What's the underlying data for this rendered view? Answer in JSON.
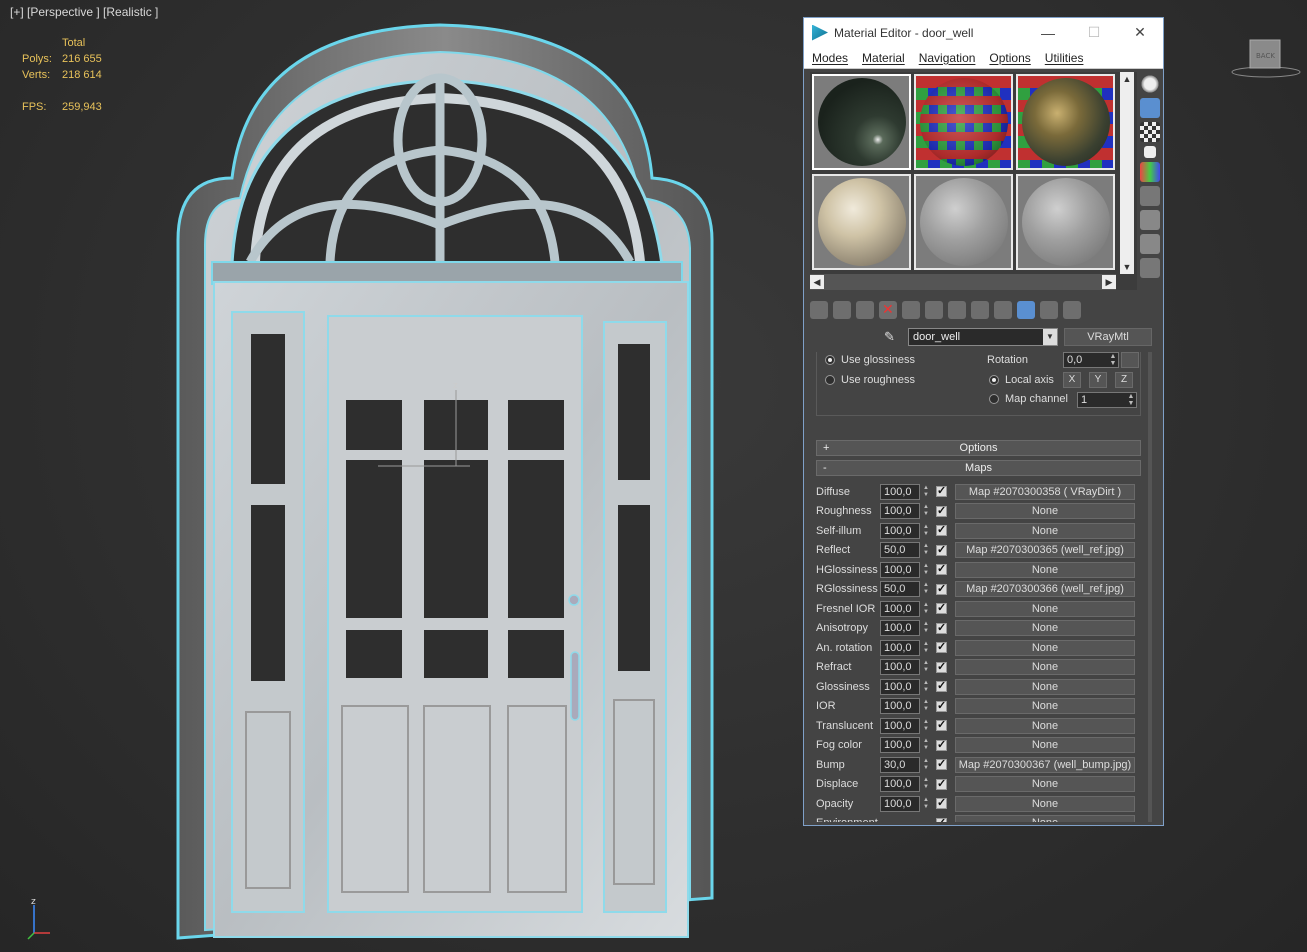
{
  "viewport": {
    "label": "[+] [Perspective ] [Realistic ]",
    "stats": {
      "header": "Total",
      "polys_label": "Polys:",
      "polys_value": "216 655",
      "verts_label": "Verts:",
      "verts_value": "218 614",
      "fps_label": "FPS:",
      "fps_value": "259,943"
    },
    "gizmo_axis_label": "z",
    "viewcube_label": "BACK"
  },
  "material_editor": {
    "title": "Material Editor - door_well",
    "window_buttons": {
      "minimize": "—",
      "maximize": "☐",
      "close": "✕"
    },
    "menu": [
      "Modes",
      "Material",
      "Navigation",
      "Options",
      "Utilities"
    ],
    "material_name": "door_well",
    "material_type": "VRayMtl",
    "glossiness": {
      "use_glossiness": "Use glossiness",
      "use_roughness": "Use roughness",
      "rotation_label": "Rotation",
      "rotation_value": "0,0",
      "local_axis": "Local axis",
      "axes": [
        "X",
        "Y",
        "Z"
      ],
      "map_channel": "Map channel",
      "map_channel_value": "1"
    },
    "sections": {
      "options": "Options",
      "options_sign": "+",
      "maps": "Maps",
      "maps_sign": "-"
    },
    "maps": [
      {
        "label": "Diffuse",
        "amount": "100,0",
        "map": "Map #2070300358  ( VRayDirt )"
      },
      {
        "label": "Roughness",
        "amount": "100,0",
        "map": "None"
      },
      {
        "label": "Self-illum",
        "amount": "100,0",
        "map": "None"
      },
      {
        "label": "Reflect",
        "amount": "50,0",
        "map": "Map #2070300365 (well_ref.jpg)"
      },
      {
        "label": "HGlossiness",
        "amount": "100,0",
        "map": "None"
      },
      {
        "label": "RGlossiness",
        "amount": "50,0",
        "map": "Map #2070300366 (well_ref.jpg)"
      },
      {
        "label": "Fresnel IOR",
        "amount": "100,0",
        "map": "None"
      },
      {
        "label": "Anisotropy",
        "amount": "100,0",
        "map": "None"
      },
      {
        "label": "An. rotation",
        "amount": "100,0",
        "map": "None"
      },
      {
        "label": "Refract",
        "amount": "100,0",
        "map": "None"
      },
      {
        "label": "Glossiness",
        "amount": "100,0",
        "map": "None"
      },
      {
        "label": "IOR",
        "amount": "100,0",
        "map": "None"
      },
      {
        "label": "Translucent",
        "amount": "100,0",
        "map": "None"
      },
      {
        "label": "Fog color",
        "amount": "100,0",
        "map": "None"
      },
      {
        "label": "Bump",
        "amount": "30,0",
        "map": "Map #2070300367 (well_bump.jpg)"
      },
      {
        "label": "Displace",
        "amount": "100,0",
        "map": "None"
      },
      {
        "label": "Opacity",
        "amount": "100,0",
        "map": "None"
      },
      {
        "label": "Environment",
        "amount": "",
        "map": "None"
      }
    ]
  }
}
